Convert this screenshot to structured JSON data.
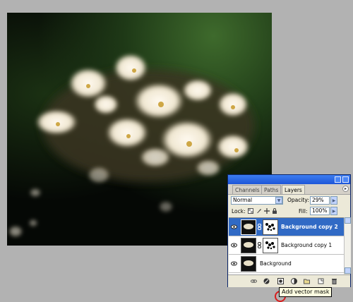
{
  "tabs": [
    {
      "label": "Channels"
    },
    {
      "label": "Paths"
    },
    {
      "label": "Layers"
    }
  ],
  "blend_mode": "Normal",
  "opacity": {
    "label": "Opacity:",
    "value": "29%"
  },
  "lock": {
    "label": "Lock:"
  },
  "fill": {
    "label": "Fill:",
    "value": "100%"
  },
  "layers": [
    {
      "name": "Background copy 2",
      "selected": true,
      "has_mask": true
    },
    {
      "name": "Background copy 1",
      "selected": false,
      "has_mask": true
    },
    {
      "name": "Background",
      "selected": false,
      "has_mask": false
    }
  ],
  "tooltip": "Add vector mask",
  "colors": {
    "selection": "#316ac5",
    "titlebar": "#1d55d8",
    "highlight_ring": "#d81c1c"
  }
}
